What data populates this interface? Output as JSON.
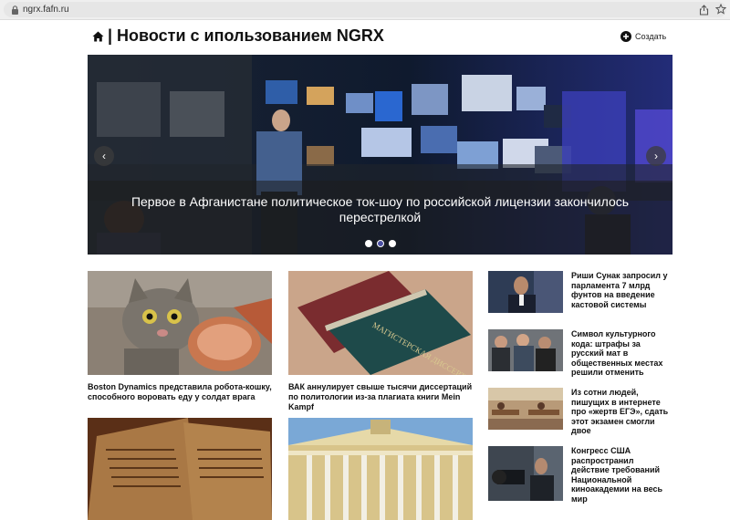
{
  "browser": {
    "url": "ngrx.fafn.ru"
  },
  "header": {
    "title": "| Новости с ипользованием NGRX",
    "create_label": "Создать"
  },
  "carousel": {
    "caption": "Первое в Афганистане политическое ток-шоу по российской лицензии закончилось перестрелкой",
    "prev_label": "‹",
    "next_label": "›",
    "slide_count": 3,
    "active_slide": 2
  },
  "cards": [
    {
      "title": "Boston Dynamics представила робота-кошку, способного воровать еду у солдат врага",
      "image": "cat-with-ham-photo"
    },
    {
      "title": "ВАК аннулирует свыше тысячи диссертаций по политологии из-за плагиата книги Mein Kampf",
      "image": "dissertation-book-photo",
      "book_text": "МАГИСТЕРСКАЯ ДИССЕРТАЦИЯ"
    },
    {
      "title": "",
      "image": "old-manuscript-photo"
    },
    {
      "title": "",
      "image": "academy-building-photo"
    }
  ],
  "side_news": [
    {
      "title": "Риши Сунак запросил у парламента 7 млрд фунтов на введение кастовой системы",
      "image": "politician-photo"
    },
    {
      "title": "Символ культурного кода: штрафы за русский мат в общественных местах решили отменить",
      "image": "crowd-photo"
    },
    {
      "title": "Из сотни людей, пишущих в интернете про «жертв ЕГЭ», сдать этот экзамен смогли двое",
      "image": "exam-room-photo"
    },
    {
      "title": "Конгресс США распространил действие требований Национальной киноакадемии на весь мир",
      "image": "camera-operator-photo"
    }
  ],
  "colors": {
    "accent_dot": "#4a4fa3",
    "caption_band": "#1e1e1e"
  }
}
